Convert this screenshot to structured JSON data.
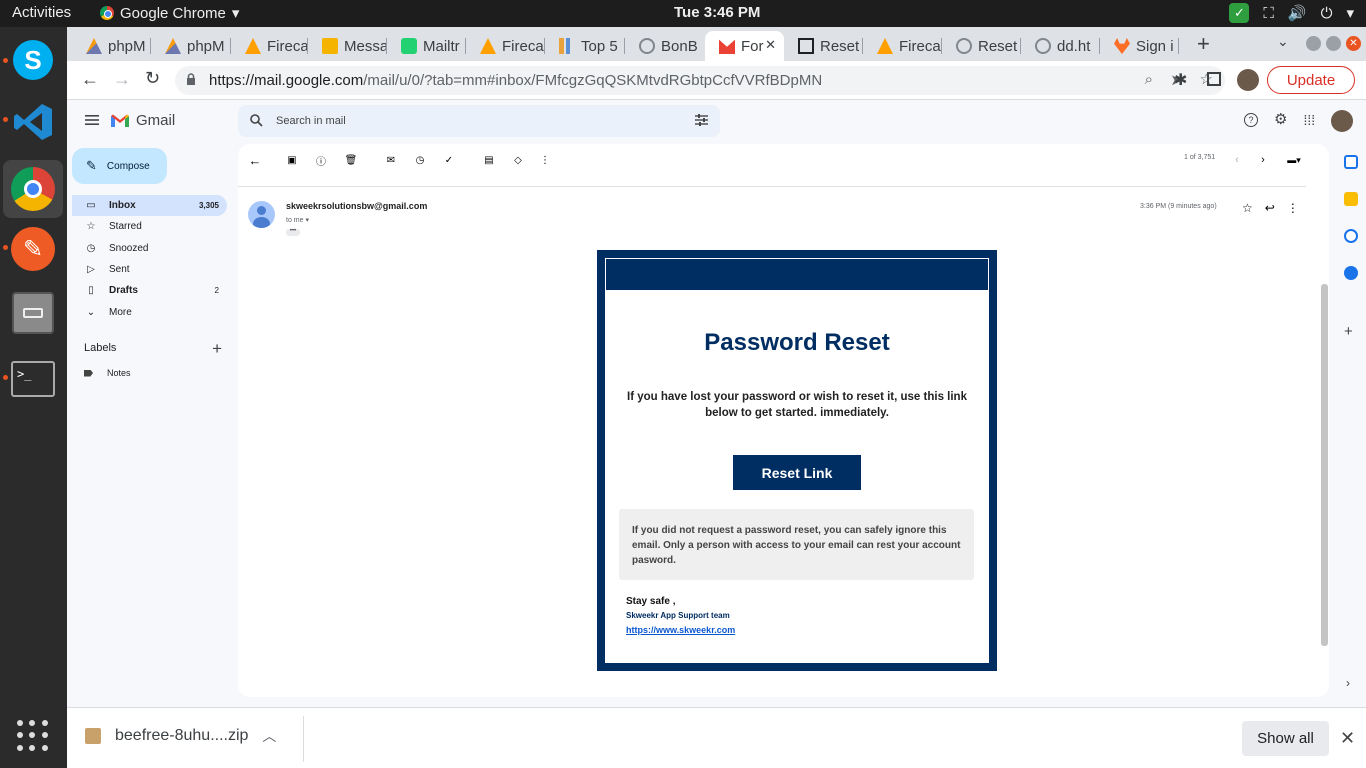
{
  "os": {
    "activities": "Activities",
    "app_name": "Google Chrome",
    "clock": "Tue  3:46 PM"
  },
  "browser": {
    "tabs": [
      {
        "label": "phpM",
        "icon": "phpmyadmin-icon"
      },
      {
        "label": "phpM",
        "icon": "phpmyadmin-icon"
      },
      {
        "label": "Fireca",
        "icon": "firebase-icon"
      },
      {
        "label": "Messa",
        "icon": "gmail-envelope-icon"
      },
      {
        "label": "Mailtr",
        "icon": "mailtrap-icon"
      },
      {
        "label": "Fireca",
        "icon": "firebase-icon"
      },
      {
        "label": "Top 5",
        "icon": "chart-icon"
      },
      {
        "label": "BonB",
        "icon": "globe-icon"
      },
      {
        "label": "For",
        "icon": "gmail-icon"
      },
      {
        "label": "Reset",
        "icon": "codesandbox-icon"
      },
      {
        "label": "Fireca",
        "icon": "firebase-icon"
      },
      {
        "label": "Reset",
        "icon": "globe-icon"
      },
      {
        "label": "dd.ht",
        "icon": "globe-icon"
      },
      {
        "label": "Sign i",
        "icon": "gitlab-icon"
      }
    ],
    "url_host": "https://mail.google.com",
    "url_rest": "/mail/u/0/?tab=mm#inbox/FMfcgzGqQSKMtvdRGbtpCcfVVRfBDpMN",
    "update_label": "Update"
  },
  "gmail": {
    "logo_text": "Gmail",
    "search_placeholder": "Search in mail",
    "compose_label": "Compose",
    "nav": [
      {
        "label": "Inbox",
        "count": "3,305",
        "icon": "inbox-icon"
      },
      {
        "label": "Starred",
        "count": "",
        "icon": "star-icon"
      },
      {
        "label": "Snoozed",
        "count": "",
        "icon": "clock-icon"
      },
      {
        "label": "Sent",
        "count": "",
        "icon": "send-icon"
      },
      {
        "label": "Drafts",
        "count": "2",
        "icon": "draft-icon"
      },
      {
        "label": "More",
        "count": "",
        "icon": "chevron-down-icon"
      }
    ],
    "labels_title": "Labels",
    "labels": [
      {
        "label": "Notes"
      }
    ],
    "paging": "1 of 3,751",
    "message": {
      "sender": "skweekrsolutionsbw@gmail.com",
      "to": "to me",
      "time": "3:36 PM (9 minutes ago)"
    },
    "email": {
      "title": "Password Reset",
      "body": "If you have lost your password or wish to reset it, use this link below to get started. immediately.",
      "button": "Reset Link",
      "notice": "If you did not request a password reset, you can safely ignore this email. Only a person with access to your email can rest your account pasword.",
      "sign_off": "Stay safe ,",
      "team": "Skweekr App Support team",
      "link": "https://www.skweekr.com"
    }
  },
  "downloads": {
    "file": "beefree-8uhu....zip",
    "show_all": "Show all"
  }
}
